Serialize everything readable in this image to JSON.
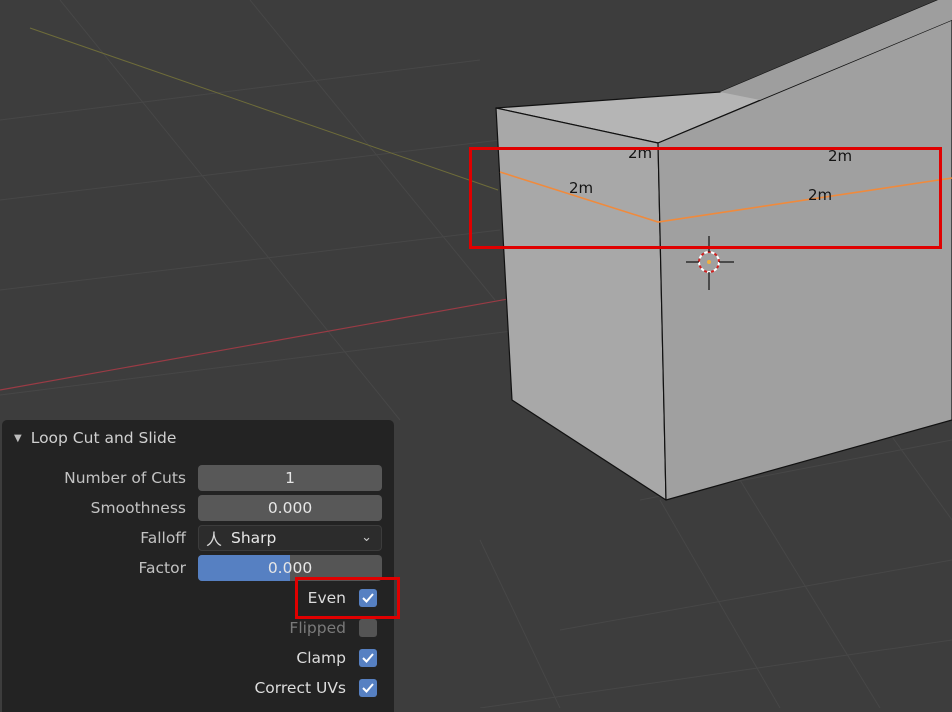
{
  "viewport": {
    "dimension_labels": [
      "2m",
      "2m",
      "2m",
      "2m"
    ]
  },
  "panel": {
    "title": "Loop Cut and Slide",
    "number_of_cuts": {
      "label": "Number of Cuts",
      "value": "1"
    },
    "smoothness": {
      "label": "Smoothness",
      "value": "0.000"
    },
    "falloff": {
      "label": "Falloff",
      "value": "Sharp",
      "icon": "sharp-falloff-icon"
    },
    "factor": {
      "label": "Factor",
      "value": "0.000"
    },
    "options": [
      {
        "label": "Even",
        "checked": true
      },
      {
        "label": "Flipped",
        "checked": false
      },
      {
        "label": "Clamp",
        "checked": true
      },
      {
        "label": "Correct UVs",
        "checked": true
      }
    ]
  },
  "colors": {
    "viewport_bg": "#3d3d3d",
    "panel_bg": "#232323",
    "accent_blue": "#5680c2",
    "highlight_red": "#e00000",
    "edge_orange": "#f08a3c"
  }
}
